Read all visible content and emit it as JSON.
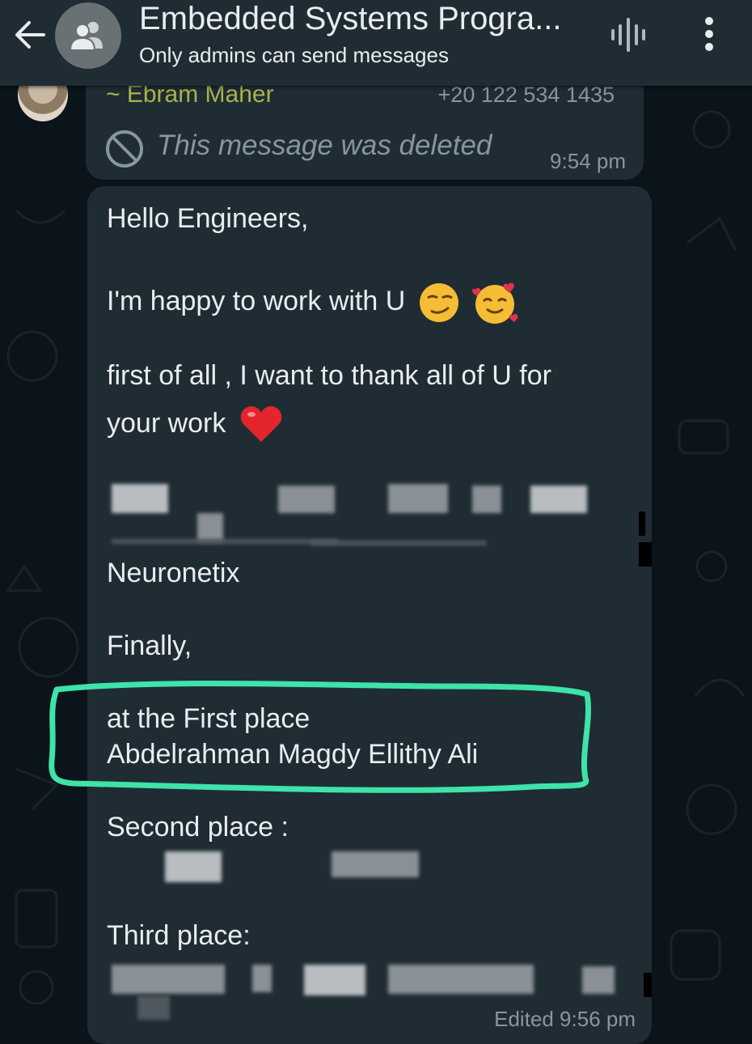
{
  "header": {
    "title": "Embedded Systems Progra...",
    "subtitle": "Only admins can send messages"
  },
  "prev_message": {
    "sender": "~ Ebram Maher",
    "phone": "+20 122 534 1435",
    "text": "This message was deleted",
    "time": "9:54 pm"
  },
  "message": {
    "greeting": "Hello Engineers,",
    "happy": "I'm happy to work with U",
    "thanks_1": "first of all , I want to thank all of U for",
    "thanks_2": "your work",
    "neuronetix": "Neuronetix",
    "finally": "Finally,",
    "first_place": "at the First place",
    "first_name": "Abdelrahman Magdy Ellithy Ali",
    "second_place": "Second place :",
    "third_place": "Third place:",
    "time": "Edited 9:56 pm"
  },
  "colors": {
    "header_bg": "#1f2c34",
    "bubble_bg": "#1f2c34",
    "highlight": "#3ee3a8",
    "sender_name": "#a8b34b"
  }
}
